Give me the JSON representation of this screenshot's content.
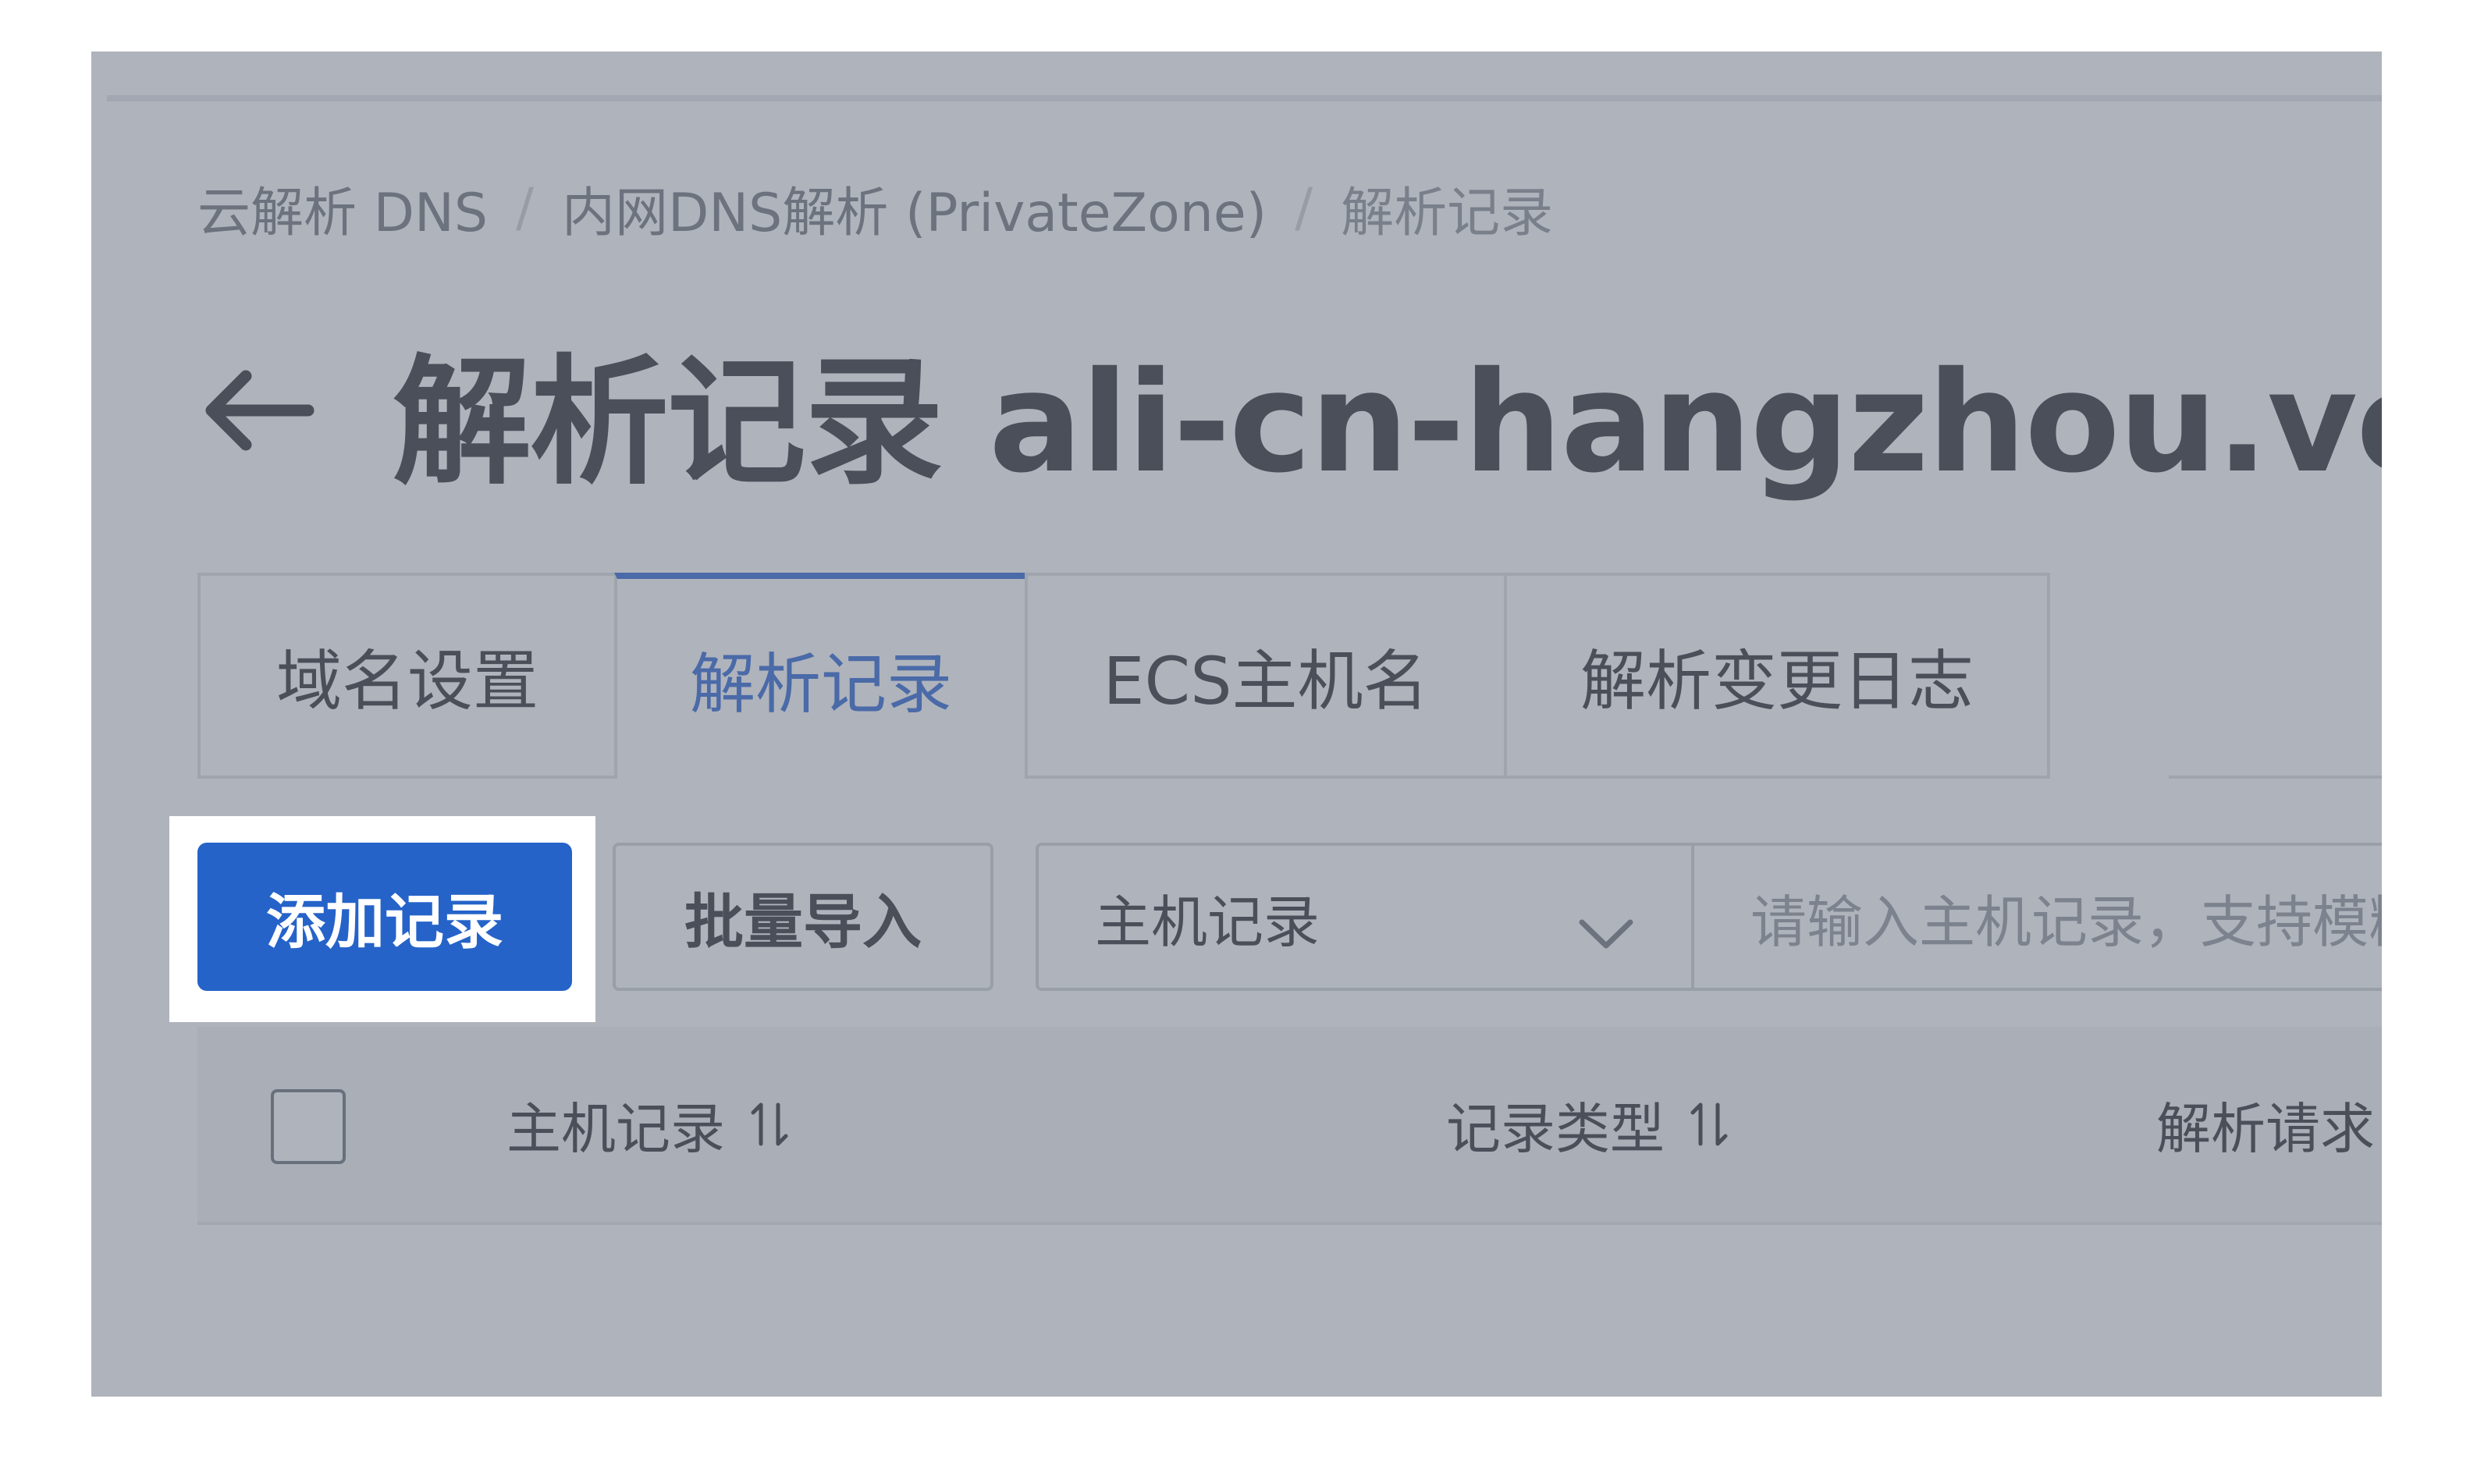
{
  "breadcrumb": {
    "items": [
      "云解析 DNS",
      "内网DNS解析 (PrivateZone)",
      "解析记录"
    ],
    "separator": "/"
  },
  "header": {
    "title": "解析记录 ali-cn-hangzhou.vectordb"
  },
  "tabs": [
    {
      "label": "域名设置",
      "active": false
    },
    {
      "label": "解析记录",
      "active": true
    },
    {
      "label": "ECS主机名",
      "active": false
    },
    {
      "label": "解析变更日志",
      "active": false
    }
  ],
  "toolbar": {
    "add_record_label": "添加记录",
    "batch_import_label": "批量导入",
    "filter_select": {
      "selected": "主机记录"
    },
    "search": {
      "placeholder": "请输入主机记录，支持模糊"
    }
  },
  "table": {
    "columns": [
      "主机记录",
      "记录类型",
      "解析请求"
    ]
  },
  "colors": {
    "accent": "#1f5dd4",
    "primary_button": "#2563c9",
    "overlay": "#6e7583"
  },
  "icons": {
    "back": "back-arrow-icon",
    "dropdown": "chevron-down-icon",
    "sort": "sort-icon"
  }
}
